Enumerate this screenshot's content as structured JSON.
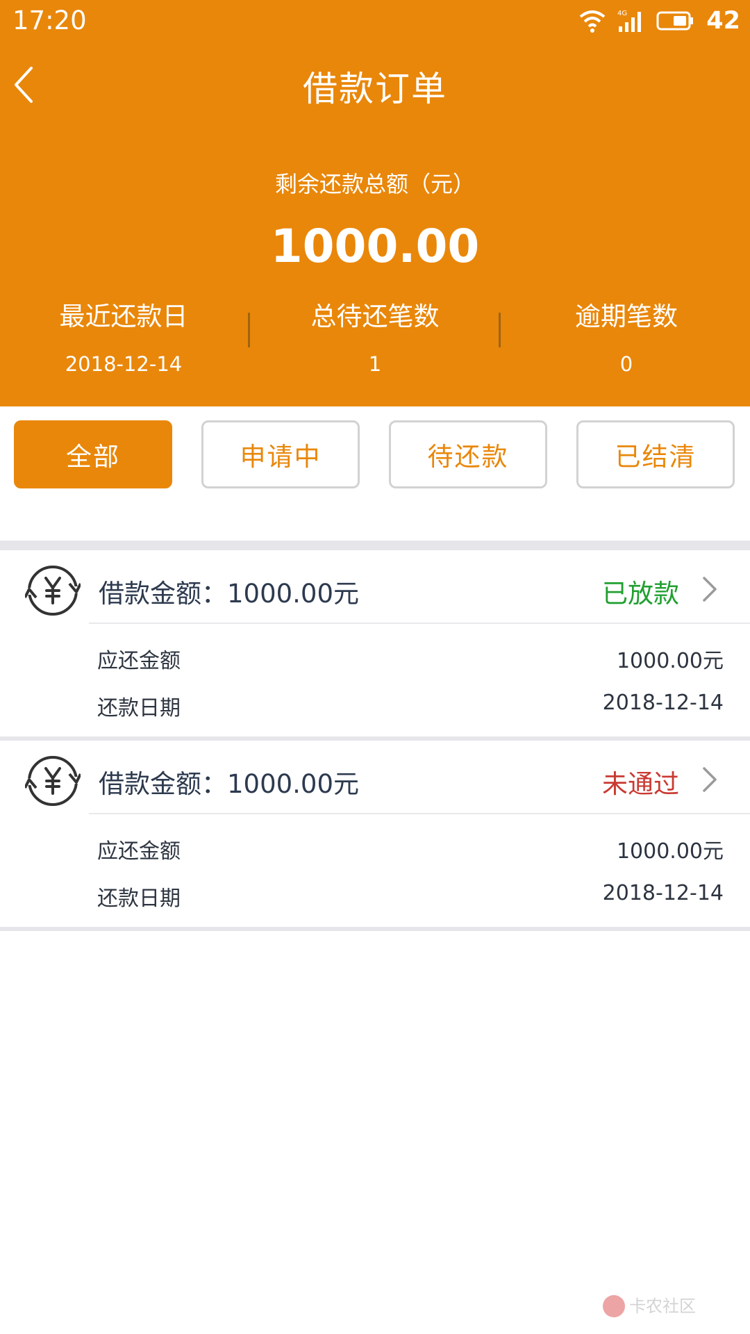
{
  "status_bar": {
    "time": "17:20",
    "network": "4G",
    "battery": "42"
  },
  "nav": {
    "title": "借款订单"
  },
  "summary": {
    "label": "剩余还款总额（元）",
    "amount": "1000.00",
    "stats": [
      {
        "label": "最近还款日",
        "value": "2018-12-14"
      },
      {
        "label": "总待还笔数",
        "value": "1"
      },
      {
        "label": "逾期笔数",
        "value": "0"
      }
    ]
  },
  "filters": [
    {
      "label": "全部",
      "active": true
    },
    {
      "label": "申请中",
      "active": false
    },
    {
      "label": "待还款",
      "active": false
    },
    {
      "label": "已结清",
      "active": false
    }
  ],
  "orders": [
    {
      "amount_text": "借款金额：1000.00元",
      "status": "已放款",
      "status_color": "#20a030",
      "due_label": "应还金额",
      "due_value": "1000.00元",
      "date_label": "还款日期",
      "date_value": "2018-12-14"
    },
    {
      "amount_text": "借款金额：1000.00元",
      "status": "未通过",
      "status_color": "#c93a32",
      "due_label": "应还金额",
      "due_value": "1000.00元",
      "date_label": "还款日期",
      "date_value": "2018-12-14"
    }
  ],
  "watermark": {
    "text": "卡农社区"
  },
  "colors": {
    "brand": "#e9870a",
    "approved": "#20a030",
    "rejected": "#c93a32"
  }
}
